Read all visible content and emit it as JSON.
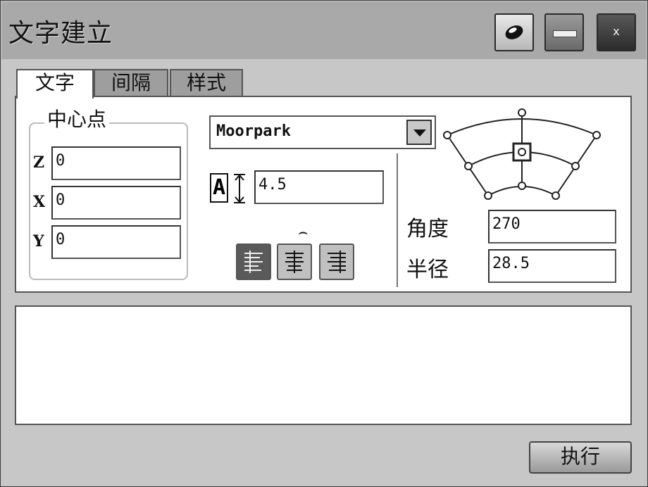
{
  "window": {
    "title": "文字建立",
    "close_label": "x"
  },
  "tabs": [
    {
      "label": "文字",
      "active": true
    },
    {
      "label": "间隔",
      "active": false
    },
    {
      "label": "样式",
      "active": false
    }
  ],
  "center_point": {
    "legend": "中心点",
    "fields": [
      {
        "axis": "Z",
        "value": "0"
      },
      {
        "axis": "X",
        "value": "0"
      },
      {
        "axis": "Y",
        "value": "0"
      }
    ]
  },
  "font": {
    "selected": "Moorpark"
  },
  "text_height": {
    "icon_letter": "A",
    "value": "4.5"
  },
  "alignment": {
    "curve_glyph": "⌢",
    "buttons": [
      "align-left",
      "align-center",
      "align-right"
    ],
    "active_index": 0
  },
  "arc": {
    "angle_label": "角度",
    "angle_value": "270",
    "radius_label": "半径",
    "radius_value": "28.5"
  },
  "actions": {
    "execute_label": "执行"
  },
  "colors": {
    "title_bar": "#a9a9a9",
    "window_bg": "#c7c7c7",
    "panel_bg": "#ffffff",
    "active_button": "#5a5a5a"
  },
  "icons": {
    "pin": "pin-icon",
    "minimize": "minimize-icon",
    "close": "close-icon",
    "dropdown": "chevron-down-icon",
    "text_height": "text-height-icon"
  }
}
